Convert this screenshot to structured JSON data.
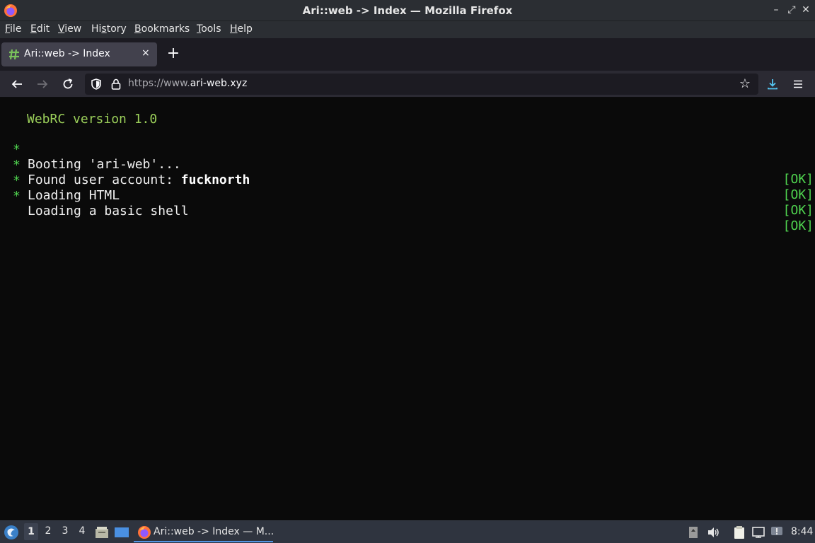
{
  "window": {
    "title": "Ari::web -> Index — Mozilla Firefox",
    "controls": [
      "minimize-icon",
      "maximize-icon",
      "close-icon"
    ]
  },
  "menubar": {
    "items": [
      {
        "label": "File",
        "accel": "F"
      },
      {
        "label": "Edit",
        "accel": "E"
      },
      {
        "label": "View",
        "accel": "V"
      },
      {
        "label": "History",
        "accel": "s"
      },
      {
        "label": "Bookmarks",
        "accel": "B"
      },
      {
        "label": "Tools",
        "accel": "T"
      },
      {
        "label": "Help",
        "accel": "H"
      }
    ]
  },
  "tabs": [
    {
      "label": "Ari::web -> Index",
      "close": "×"
    }
  ],
  "newtab": {
    "label": "+"
  },
  "navbar": {
    "url_prefix": "https://www.",
    "url_host": "ari-web.xyz"
  },
  "terminal": {
    "version": "WebRC version 1.0",
    "lines": [
      {
        "bullet": "*",
        "text": "Booting 'ari-web'...",
        "bold": "",
        "status": "[OK]"
      },
      {
        "bullet": "*",
        "text": "Found user account: ",
        "bold": "fucknorth",
        "status": "[OK]"
      },
      {
        "bullet": "*",
        "text": "Loading HTML",
        "bold": "",
        "status": "[OK]"
      },
      {
        "bullet": "*",
        "text": "Loading a basic shell",
        "bold": "",
        "status": "[OK]"
      }
    ]
  },
  "taskbar": {
    "workspaces": [
      "1",
      "2",
      "3",
      "4"
    ],
    "active_workspace": "1",
    "task_label": "Ari::web -> Index — M...",
    "clock": "8:44"
  },
  "colors": {
    "ok_green": "#4fd34f",
    "version_green": "#9bcf5a",
    "accent_blue": "#5294e2"
  }
}
